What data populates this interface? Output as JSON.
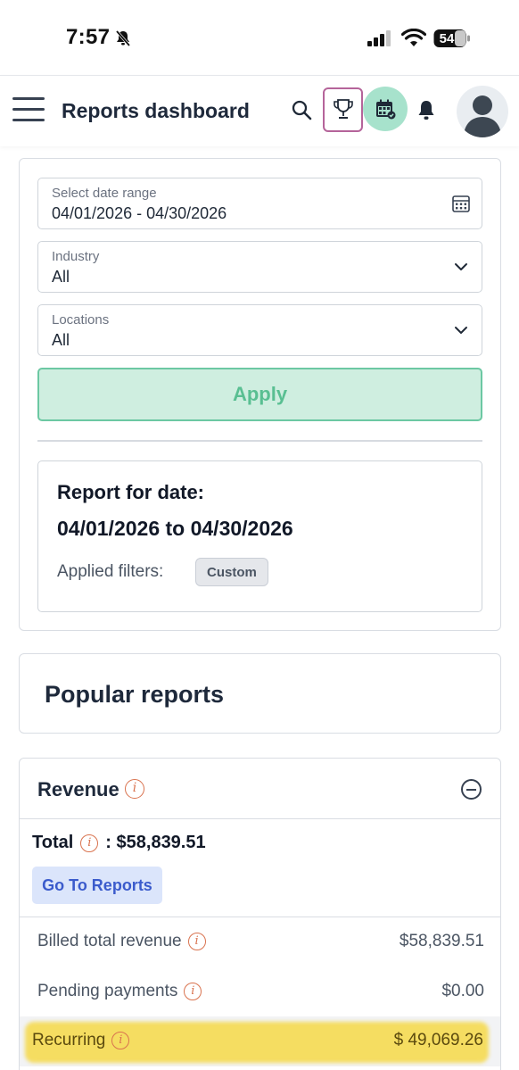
{
  "status_bar": {
    "time": "7:57",
    "battery": "54"
  },
  "header": {
    "title": "Reports dashboard",
    "icons": [
      "menu-icon",
      "search-icon",
      "trophy-icon",
      "calendar-icon",
      "bell-icon",
      "avatar"
    ]
  },
  "filters": {
    "date_range": {
      "label": "Select date range",
      "value": "04/01/2026 - 04/30/2026"
    },
    "industry": {
      "label": "Industry",
      "value": "All"
    },
    "locations": {
      "label": "Locations",
      "value": "All"
    },
    "apply_label": "Apply"
  },
  "report_summary": {
    "label": "Report for date:",
    "dates": "04/01/2026 to 04/30/2026",
    "applied_filters_label": "Applied filters:",
    "applied_filter_badge": "Custom"
  },
  "popular_reports": {
    "title": "Popular reports"
  },
  "revenue": {
    "title": "Revenue",
    "total_label": "Total",
    "total_value": ": $58,839.51",
    "go_to_reports_label": "Go To Reports",
    "rows": [
      {
        "label": "Billed total revenue",
        "value": "$58,839.51"
      },
      {
        "label": "Pending payments",
        "value": "$0.00"
      },
      {
        "label": "Recurring",
        "value": "$ 49,069.26",
        "highlighted": true
      }
    ]
  },
  "colors": {
    "accent_green": "#6cc8a3",
    "apply_bg": "#cfeee0",
    "info_orange": "#d9734f",
    "link_blue": "#3b5bcc",
    "highlight_yellow": "#f6d637",
    "trophy_border": "#b5649a"
  }
}
